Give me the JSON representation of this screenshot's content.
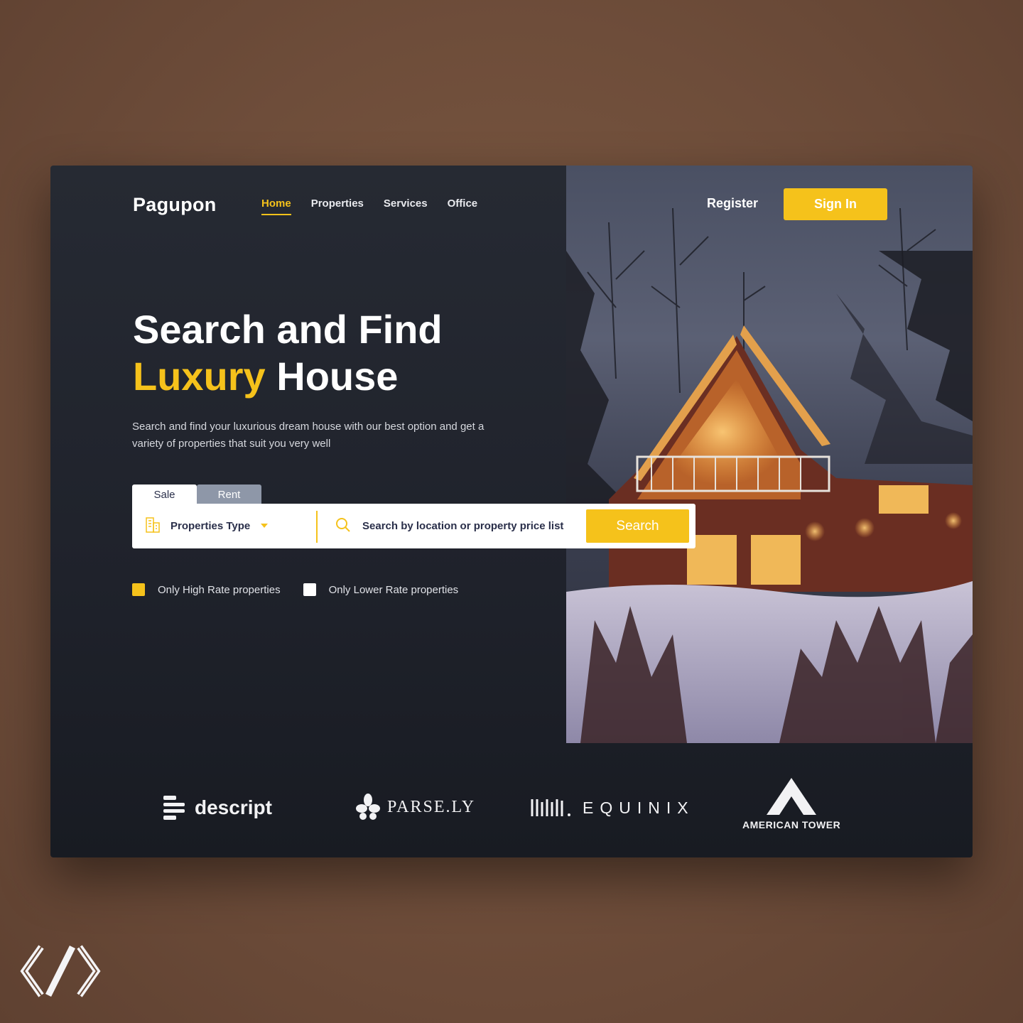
{
  "brand": {
    "name": "Pagupon"
  },
  "nav": {
    "items": [
      {
        "label": "Home",
        "active": true
      },
      {
        "label": "Properties",
        "active": false
      },
      {
        "label": "Services",
        "active": false
      },
      {
        "label": "Office",
        "active": false
      }
    ]
  },
  "auth": {
    "register_label": "Register",
    "signin_label": "Sign In"
  },
  "hero": {
    "line1": "Search and Find",
    "line2_highlight": "Luxury",
    "line2_rest": "House",
    "subtitle": "Search and find your luxurious dream house with our best option and get a variety of properties that suit you very well"
  },
  "search": {
    "tabs": [
      {
        "label": "Sale",
        "selected": true
      },
      {
        "label": "Rent",
        "selected": false
      }
    ],
    "property_type_label": "Properties Type",
    "location_placeholder": "Search by location or property price list",
    "button_label": "Search"
  },
  "filters": [
    {
      "label": "Only High Rate properties",
      "checked": true
    },
    {
      "label": "Only Lower Rate properties",
      "checked": false
    }
  ],
  "partners": {
    "descript": "descript",
    "parsely": "PARSE.LY",
    "equinix": "EQUINIX",
    "american_tower": "AMERICAN TOWER"
  },
  "colors": {
    "accent": "#f5c21b",
    "panel": "#23262f",
    "text_dark": "#2a2f4a"
  }
}
